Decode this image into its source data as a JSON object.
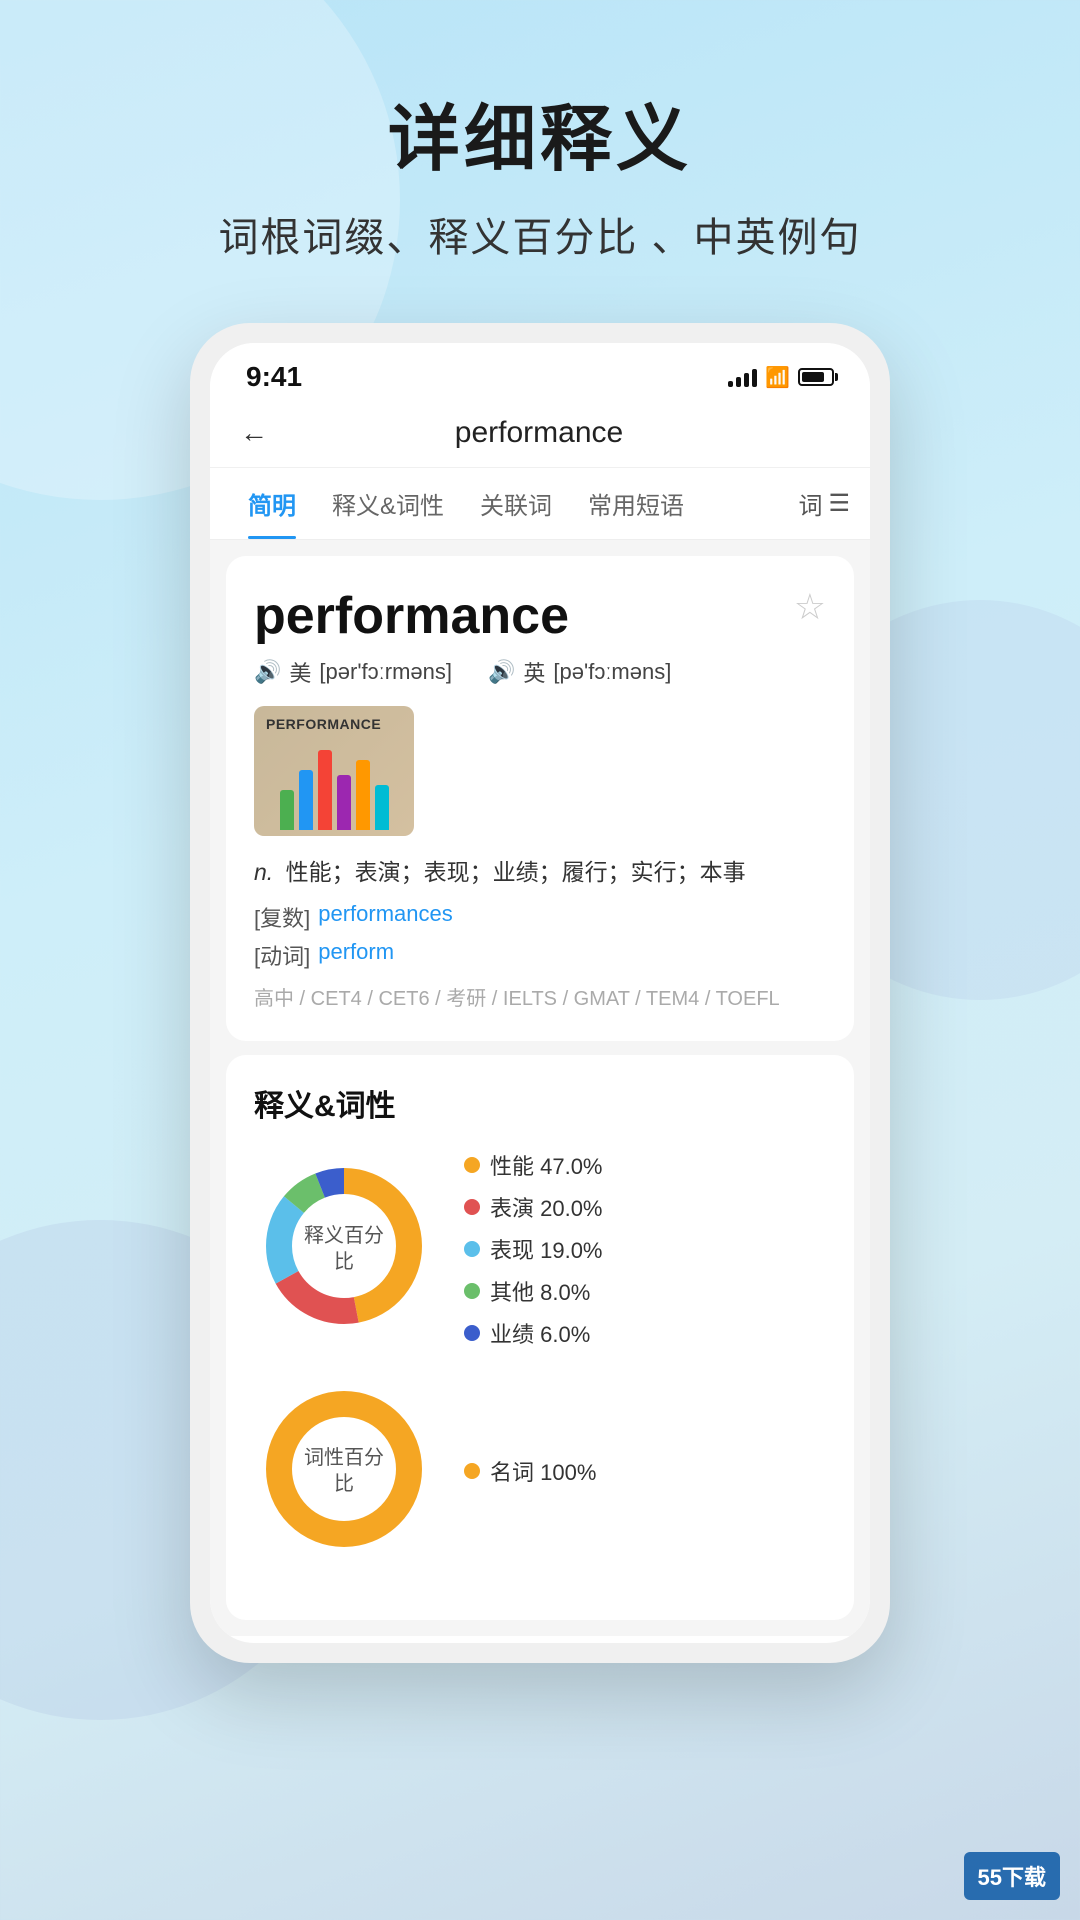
{
  "page": {
    "title": "详细释义",
    "subtitle": "词根词缀、释义百分比 、中英例句"
  },
  "status_bar": {
    "time": "9:41",
    "signal": "●●●●",
    "wifi": "WiFi",
    "battery": "80%"
  },
  "nav": {
    "back_label": "←",
    "word": "performance"
  },
  "tabs": [
    {
      "id": "brief",
      "label": "简明",
      "active": true
    },
    {
      "id": "definition",
      "label": "释义&词性",
      "active": false
    },
    {
      "id": "related",
      "label": "关联词",
      "active": false
    },
    {
      "id": "phrases",
      "label": "常用短语",
      "active": false
    },
    {
      "id": "more",
      "label": "词",
      "active": false
    }
  ],
  "word_card": {
    "word": "performance",
    "us_pron_label": "美",
    "us_pron": "[pər'fɔːrməns]",
    "uk_pron_label": "英",
    "uk_pron": "[pə'fɔːməns]",
    "pos": "n.",
    "meanings": "性能；表演；表现；业绩；履行；实行；本事",
    "plural_label": "[复数]",
    "plural": "performances",
    "verb_label": "[动词]",
    "verb": "perform",
    "levels": "高中 / CET4 / CET6 / 考研 / IELTS / GMAT / TEM4 / TOEFL",
    "star": "☆"
  },
  "def_section": {
    "title": "释义&词性",
    "donut1_label": "释义百分比",
    "donut2_label": "词性百分比",
    "legend1": [
      {
        "label": "性能 47.0%",
        "color": "#F5A623"
      },
      {
        "label": "表演 20.0%",
        "color": "#E05252"
      },
      {
        "label": "表现 19.0%",
        "color": "#5BBFEA"
      },
      {
        "label": "其他 8.0%",
        "color": "#6BBF6B"
      },
      {
        "label": "业绩 6.0%",
        "color": "#3B5ECC"
      }
    ],
    "legend2": [
      {
        "label": "名词 100%",
        "color": "#F5A623"
      }
    ],
    "donut1_segments": [
      {
        "pct": 47,
        "color": "#F5A623"
      },
      {
        "pct": 20,
        "color": "#E05252"
      },
      {
        "pct": 19,
        "color": "#5BBFEA"
      },
      {
        "pct": 8,
        "color": "#6BBF6B"
      },
      {
        "pct": 6,
        "color": "#3B5ECC"
      }
    ]
  },
  "watermark": {
    "text": "55下载"
  }
}
